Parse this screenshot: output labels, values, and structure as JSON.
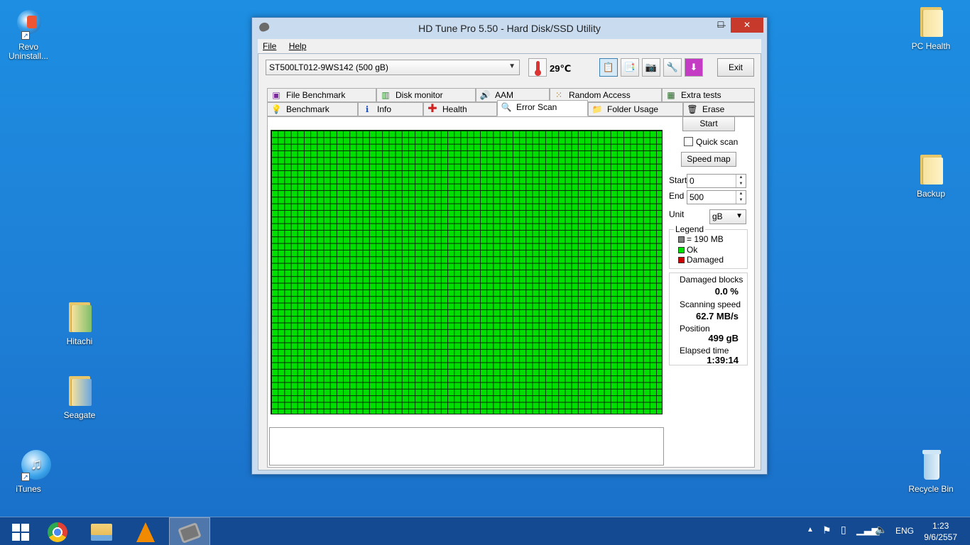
{
  "desktop": {
    "icons": {
      "revo": "Revo Uninstall...",
      "pc_health": "PC Health",
      "backup": "Backup",
      "hitachi": "Hitachi",
      "seagate": "Seagate",
      "itunes": "iTunes",
      "recycle_bin": "Recycle Bin"
    }
  },
  "window": {
    "title": "HD Tune Pro 5.50 - Hard Disk/SSD Utility",
    "controls": {
      "minimize": "—",
      "maximize": "☐",
      "close": "✕"
    },
    "menu": [
      "File",
      "Help"
    ],
    "drive": "ST500LT012-9WS142 (500 gB)",
    "temperature": "29℃",
    "exit_label": "Exit",
    "tabs_row1": [
      "File Benchmark",
      "Disk monitor",
      "AAM",
      "Random Access",
      "Extra tests"
    ],
    "tabs_row2": [
      "Benchmark",
      "Info",
      "Health",
      "Error Scan",
      "Folder Usage",
      "Erase"
    ],
    "selected_tab": "Error Scan"
  },
  "error_scan": {
    "start_button": "Start",
    "quick_scan_label": "Quick scan",
    "quick_scan_checked": false,
    "speed_map_button": "Speed map",
    "start_label": "Start",
    "start_value": "0",
    "end_label": "End",
    "end_value": "500",
    "unit_label": "Unit",
    "unit_value": "gB",
    "legend": {
      "title": "Legend",
      "block": "= 190 MB",
      "ok": "Ok",
      "damaged": "Damaged"
    },
    "stats": {
      "damaged_blocks_label": "Damaged blocks",
      "damaged_blocks_value": "0.0 %",
      "scanning_speed_label": "Scanning speed",
      "scanning_speed_value": "62.7 MB/s",
      "position_label": "Position",
      "position_value": "499 gB",
      "elapsed_label": "Elapsed time",
      "elapsed_value": "1:39:14"
    },
    "colors": {
      "ok": "#00e000",
      "damaged": "#cc0000",
      "block": "#808080"
    }
  },
  "taskbar": {
    "language": "ENG",
    "time": "1:23",
    "date": "9/6/2557"
  }
}
